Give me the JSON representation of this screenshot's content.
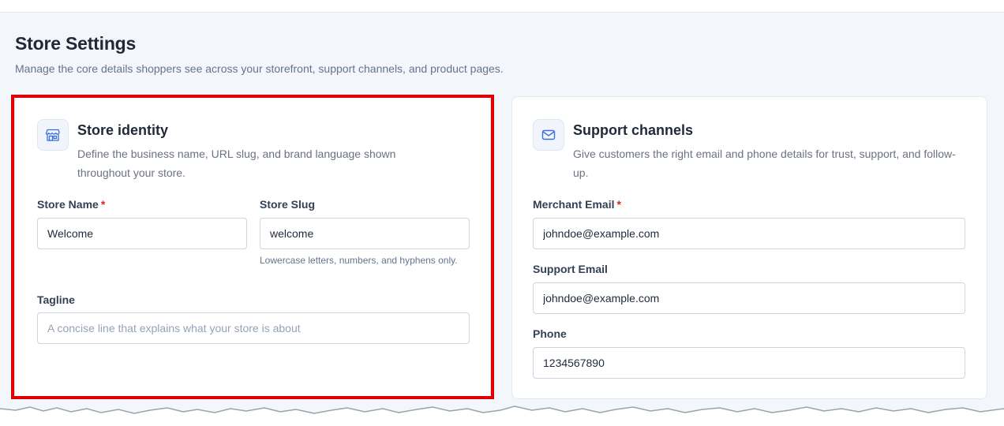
{
  "page": {
    "title": "Store Settings",
    "subtitle": "Manage the core details shoppers see across your storefront, support channels, and product pages."
  },
  "identity": {
    "icon": "storefront-icon",
    "title": "Store identity",
    "description": "Define the business name, URL slug, and brand language shown throughout your store.",
    "store_name": {
      "label": "Store Name",
      "required_mark": "*",
      "value": "Welcome"
    },
    "store_slug": {
      "label": "Store Slug",
      "value": "welcome",
      "help": "Lowercase letters, numbers, and hyphens only."
    },
    "tagline": {
      "label": "Tagline",
      "value": "",
      "placeholder": "A concise line that explains what your store is about"
    }
  },
  "support": {
    "icon": "envelope-icon",
    "title": "Support channels",
    "description": "Give customers the right email and phone details for trust, support, and follow-up.",
    "merchant_email": {
      "label": "Merchant Email",
      "required_mark": "*",
      "value": "johndoe@example.com"
    },
    "support_email": {
      "label": "Support Email",
      "value": "johndoe@example.com"
    },
    "phone": {
      "label": "Phone",
      "value": "1234567890"
    }
  },
  "colors": {
    "highlight": "#e00000",
    "required": "#dc2626",
    "icon_accent": "#3b6fd8"
  }
}
